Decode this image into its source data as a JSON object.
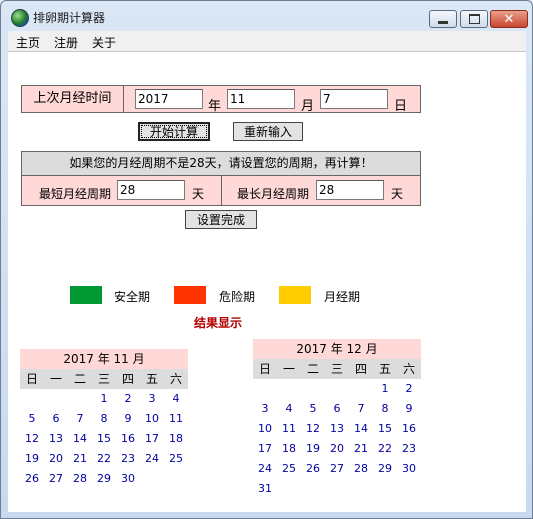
{
  "window": {
    "title": "排卵期计算器",
    "close_glyph": "✕"
  },
  "menu": [
    "主页",
    "注册",
    "关于"
  ],
  "last_period": {
    "label": "上次月经时间",
    "year_value": "2017",
    "year_unit": "年",
    "month_value": "11",
    "month_unit": "月",
    "day_value": "7",
    "day_unit": "日"
  },
  "buttons": {
    "calculate": "开始计算",
    "reset": "重新输入",
    "settings_done": "设置完成"
  },
  "cycle": {
    "notice": "如果您的月经周期不是28天，请设置您的周期，再计算！",
    "shortest_label": "最短月经周期",
    "shortest_value": "28",
    "shortest_unit": "天",
    "longest_label": "最长月经周期",
    "longest_value": "28",
    "longest_unit": "天"
  },
  "legend": [
    {
      "label": "安全期",
      "color": "#009933"
    },
    {
      "label": "危险期",
      "color": "#ff3300"
    },
    {
      "label": "月经期",
      "color": "#ffcc00"
    }
  ],
  "result_title": "结果显示",
  "weekdays": [
    "日",
    "一",
    "二",
    "三",
    "四",
    "五",
    "六"
  ],
  "calendars": [
    {
      "header": "2017 年 11 月",
      "first_weekday": 3,
      "days": 30
    },
    {
      "header": "2017 年 12 月",
      "first_weekday": 5,
      "days": 31
    }
  ]
}
